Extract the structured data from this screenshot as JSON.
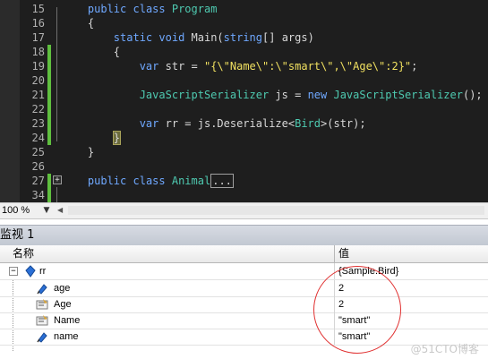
{
  "editor": {
    "lines": [
      {
        "num": "15",
        "tokens": [
          {
            "t": "    "
          },
          {
            "t": "public",
            "c": "kw"
          },
          {
            "t": " "
          },
          {
            "t": "class",
            "c": "kw"
          },
          {
            "t": " "
          },
          {
            "t": "Program",
            "c": "ty"
          }
        ]
      },
      {
        "num": "16",
        "tokens": [
          {
            "t": "    {"
          }
        ]
      },
      {
        "num": "17",
        "tokens": [
          {
            "t": "        "
          },
          {
            "t": "static",
            "c": "kw"
          },
          {
            "t": " "
          },
          {
            "t": "void",
            "c": "kw"
          },
          {
            "t": " Main("
          },
          {
            "t": "string",
            "c": "kw"
          },
          {
            "t": "[] args)"
          }
        ]
      },
      {
        "num": "18",
        "tokens": [
          {
            "t": "        {"
          }
        ]
      },
      {
        "num": "19",
        "tokens": [
          {
            "t": "            "
          },
          {
            "t": "var",
            "c": "kw"
          },
          {
            "t": " str = "
          },
          {
            "t": "\"{\\\"Name\\\":\\\"smart\\\",\\\"Age\\\":2}\"",
            "c": "str"
          },
          {
            "t": ";"
          }
        ]
      },
      {
        "num": "20",
        "tokens": []
      },
      {
        "num": "21",
        "tokens": [
          {
            "t": "            "
          },
          {
            "t": "JavaScriptSerializer",
            "c": "ty"
          },
          {
            "t": " js = "
          },
          {
            "t": "new",
            "c": "kw"
          },
          {
            "t": " "
          },
          {
            "t": "JavaScriptSerializer",
            "c": "ty"
          },
          {
            "t": "();"
          }
        ]
      },
      {
        "num": "22",
        "tokens": []
      },
      {
        "num": "23",
        "tokens": [
          {
            "t": "            "
          },
          {
            "t": "var",
            "c": "kw"
          },
          {
            "t": " rr = js.Deserialize<"
          },
          {
            "t": "Bird",
            "c": "ty"
          },
          {
            "t": ">(str);"
          }
        ]
      },
      {
        "num": "24",
        "tokens": [
          {
            "t": "        "
          },
          {
            "t": "}",
            "c": "hl"
          }
        ]
      },
      {
        "num": "25",
        "tokens": [
          {
            "t": "    }"
          }
        ]
      },
      {
        "num": "26",
        "tokens": []
      },
      {
        "num": "27",
        "tokens": [
          {
            "t": "    "
          },
          {
            "t": "public",
            "c": "kw"
          },
          {
            "t": " "
          },
          {
            "t": "class",
            "c": "kw"
          },
          {
            "t": " "
          },
          {
            "t": "Animal",
            "c": "ty"
          },
          {
            "t": "...",
            "c": "collapsed"
          }
        ]
      },
      {
        "num": "34",
        "tokens": []
      }
    ]
  },
  "zoom": {
    "value": "100 %"
  },
  "watch": {
    "title": "监视 1",
    "col_name": "名称",
    "col_value": "值",
    "rows": [
      {
        "name": "rr",
        "value": "{Sample.Bird}",
        "icon": "field-icon"
      },
      {
        "name": "age",
        "value": "2",
        "icon": "field-icon"
      },
      {
        "name": "Age",
        "value": "2",
        "icon": "property-icon"
      },
      {
        "name": "Name",
        "value": "\"smart\"",
        "icon": "property-icon"
      },
      {
        "name": "name",
        "value": "\"smart\"",
        "icon": "field-icon"
      }
    ]
  },
  "watermark": "@51CTO博客",
  "colors": {
    "annotation_circle": "#e03030",
    "change_bar": "#5fbf3f",
    "breakpoint_arrow": "#f4a21a"
  }
}
